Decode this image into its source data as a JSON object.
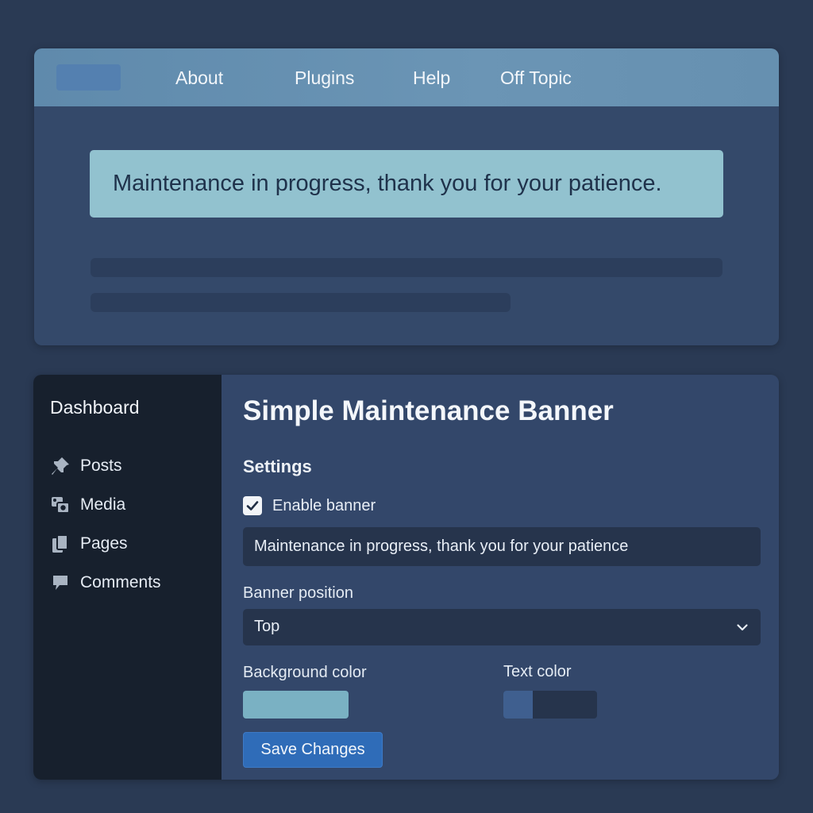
{
  "preview": {
    "nav": {
      "items": [
        {
          "label": "About"
        },
        {
          "label": "Plugins"
        },
        {
          "label": "Help"
        },
        {
          "label": "Off Topic"
        }
      ]
    },
    "banner_text": "Maintenance in progress, thank you for your patience."
  },
  "sidebar": {
    "title": "Dashboard",
    "items": [
      {
        "label": "Posts",
        "icon": "pin-icon"
      },
      {
        "label": "Media",
        "icon": "media-icon"
      },
      {
        "label": "Pages",
        "icon": "pages-icon"
      },
      {
        "label": "Comments",
        "icon": "comment-icon"
      }
    ]
  },
  "settings": {
    "page_title": "Simple Maintenance Banner",
    "section_title": "Settings",
    "enable_label": "Enable banner",
    "enable_checked": true,
    "message_value": "Maintenance in progress, thank you for your patience",
    "position_label": "Banner position",
    "position_value": "Top",
    "bg_color_label": "Background color",
    "bg_color": "#7ab1c3",
    "text_color_label": "Text color",
    "text_color": "#3f5f8f",
    "save_label": "Save Changes"
  }
}
